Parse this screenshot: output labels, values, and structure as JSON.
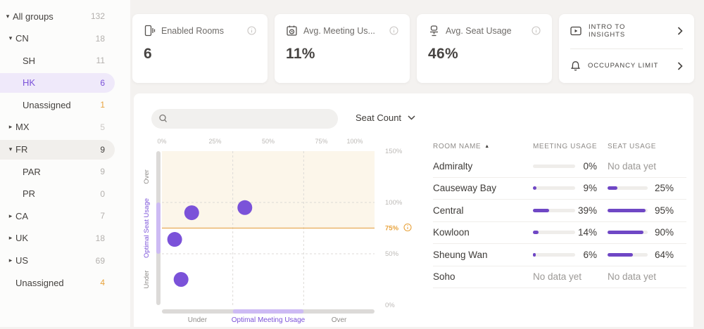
{
  "colors": {
    "accent": "#7b52d9",
    "bar_fill": "#6f47c5",
    "warning": "#e8a33d",
    "threshold_line": "#eab56b",
    "optimal_band": "#fcf6ea",
    "axis_zone_purple": "#cdbbf3"
  },
  "sidebar": {
    "items": [
      {
        "label": "All groups",
        "count": "132",
        "level": 0,
        "caret": "down",
        "count_style": "muted"
      },
      {
        "label": "CN",
        "count": "18",
        "level": 1,
        "caret": "down",
        "count_style": "muted"
      },
      {
        "label": "SH",
        "count": "11",
        "level": 2,
        "caret": null,
        "count_style": "muted"
      },
      {
        "label": "HK",
        "count": "6",
        "level": 2,
        "caret": null,
        "count_style": "accent",
        "selected": true
      },
      {
        "label": "Unassigned",
        "count": "1",
        "level": 2,
        "caret": null,
        "count_style": "warning"
      },
      {
        "label": "MX",
        "count": "5",
        "level": 1,
        "caret": "right",
        "count_style": "faint"
      },
      {
        "label": "FR",
        "count": "9",
        "level": 1,
        "caret": "down",
        "count_style": "dark",
        "hovered": true
      },
      {
        "label": "PAR",
        "count": "9",
        "level": 2,
        "caret": null,
        "count_style": "muted"
      },
      {
        "label": "PR",
        "count": "0",
        "level": 2,
        "caret": null,
        "count_style": "muted"
      },
      {
        "label": "CA",
        "count": "7",
        "level": 1,
        "caret": "right",
        "count_style": "muted"
      },
      {
        "label": "UK",
        "count": "18",
        "level": 1,
        "caret": "right",
        "count_style": "muted"
      },
      {
        "label": "US",
        "count": "69",
        "level": 1,
        "caret": "right",
        "count_style": "muted"
      },
      {
        "label": "Unassigned",
        "count": "4",
        "level": 1,
        "caret": null,
        "count_style": "warning"
      }
    ]
  },
  "cards": [
    {
      "label": "Enabled Rooms",
      "value": "6",
      "icon": "room-icon"
    },
    {
      "label": "Avg. Meeting Us...",
      "value": "11%",
      "icon": "calendar-icon"
    },
    {
      "label": "Avg. Seat Usage",
      "value": "46%",
      "icon": "seat-icon"
    }
  ],
  "links_card": {
    "items": [
      {
        "label": "INTRO TO INSIGHTS",
        "icon": "video-icon"
      },
      {
        "label": "OCCUPANCY LIMIT",
        "icon": "bell-icon"
      }
    ]
  },
  "toolbar": {
    "search_placeholder": "",
    "sort_label": "Seat Count"
  },
  "chart_data": {
    "type": "scatter",
    "x_axis": {
      "label": "Meeting Usage",
      "range": [
        0,
        100
      ],
      "ticks": [
        {
          "value": 0,
          "label": "0%"
        },
        {
          "value": 25,
          "label": "25%"
        },
        {
          "value": 50,
          "label": "50%"
        },
        {
          "value": 75,
          "label": "75%"
        },
        {
          "value": 100,
          "label": "100%"
        }
      ],
      "zones": [
        {
          "label": "Under",
          "mid": 16.7
        },
        {
          "label": "Optimal Meeting Usage",
          "mid": 50,
          "accent": true
        },
        {
          "label": "Over",
          "mid": 83.3
        }
      ]
    },
    "y_axis": {
      "label": "Seat Usage",
      "range": [
        0,
        150
      ],
      "ticks": [
        {
          "value": 150,
          "label": "150%"
        },
        {
          "value": 100,
          "label": "100%"
        },
        {
          "value": 75,
          "label": "75%",
          "accent": true
        },
        {
          "value": 50,
          "label": "50%"
        },
        {
          "value": 0,
          "label": "0%"
        }
      ],
      "zones": [
        {
          "label": "Over",
          "mid": 125
        },
        {
          "label": "Optimal Seat Usage",
          "mid": 75,
          "accent": true
        },
        {
          "label": "Under",
          "mid": 25
        }
      ]
    },
    "threshold": {
      "value": 75,
      "label": "75%"
    },
    "optimal_band": {
      "from": 75,
      "to": 150
    },
    "grid": {
      "h_lines": [
        100,
        50
      ],
      "v_lines": [
        33.33,
        66.67
      ]
    },
    "points": [
      {
        "name": "Causeway Bay",
        "x": 9,
        "y": 25
      },
      {
        "name": "Central",
        "x": 39,
        "y": 95
      },
      {
        "name": "Kowloon",
        "x": 14,
        "y": 90
      },
      {
        "name": "Sheung Wan",
        "x": 6,
        "y": 64
      }
    ]
  },
  "table": {
    "columns": [
      "ROOM NAME",
      "MEETING USAGE",
      "SEAT USAGE"
    ],
    "sort": {
      "column": "ROOM NAME",
      "direction": "asc",
      "icon": "▲"
    },
    "no_data_text": "No data yet",
    "rows": [
      {
        "name": "Admiralty",
        "meeting": 0,
        "meeting_text": "0%",
        "seat": null,
        "seat_text": "No data yet"
      },
      {
        "name": "Causeway Bay",
        "meeting": 9,
        "meeting_text": "9%",
        "seat": 25,
        "seat_text": "25%"
      },
      {
        "name": "Central",
        "meeting": 39,
        "meeting_text": "39%",
        "seat": 95,
        "seat_text": "95%"
      },
      {
        "name": "Kowloon",
        "meeting": 14,
        "meeting_text": "14%",
        "seat": 90,
        "seat_text": "90%"
      },
      {
        "name": "Sheung Wan",
        "meeting": 6,
        "meeting_text": "6%",
        "seat": 64,
        "seat_text": "64%"
      },
      {
        "name": "Soho",
        "meeting": null,
        "meeting_text": "No data yet",
        "seat": null,
        "seat_text": "No data yet"
      }
    ]
  }
}
